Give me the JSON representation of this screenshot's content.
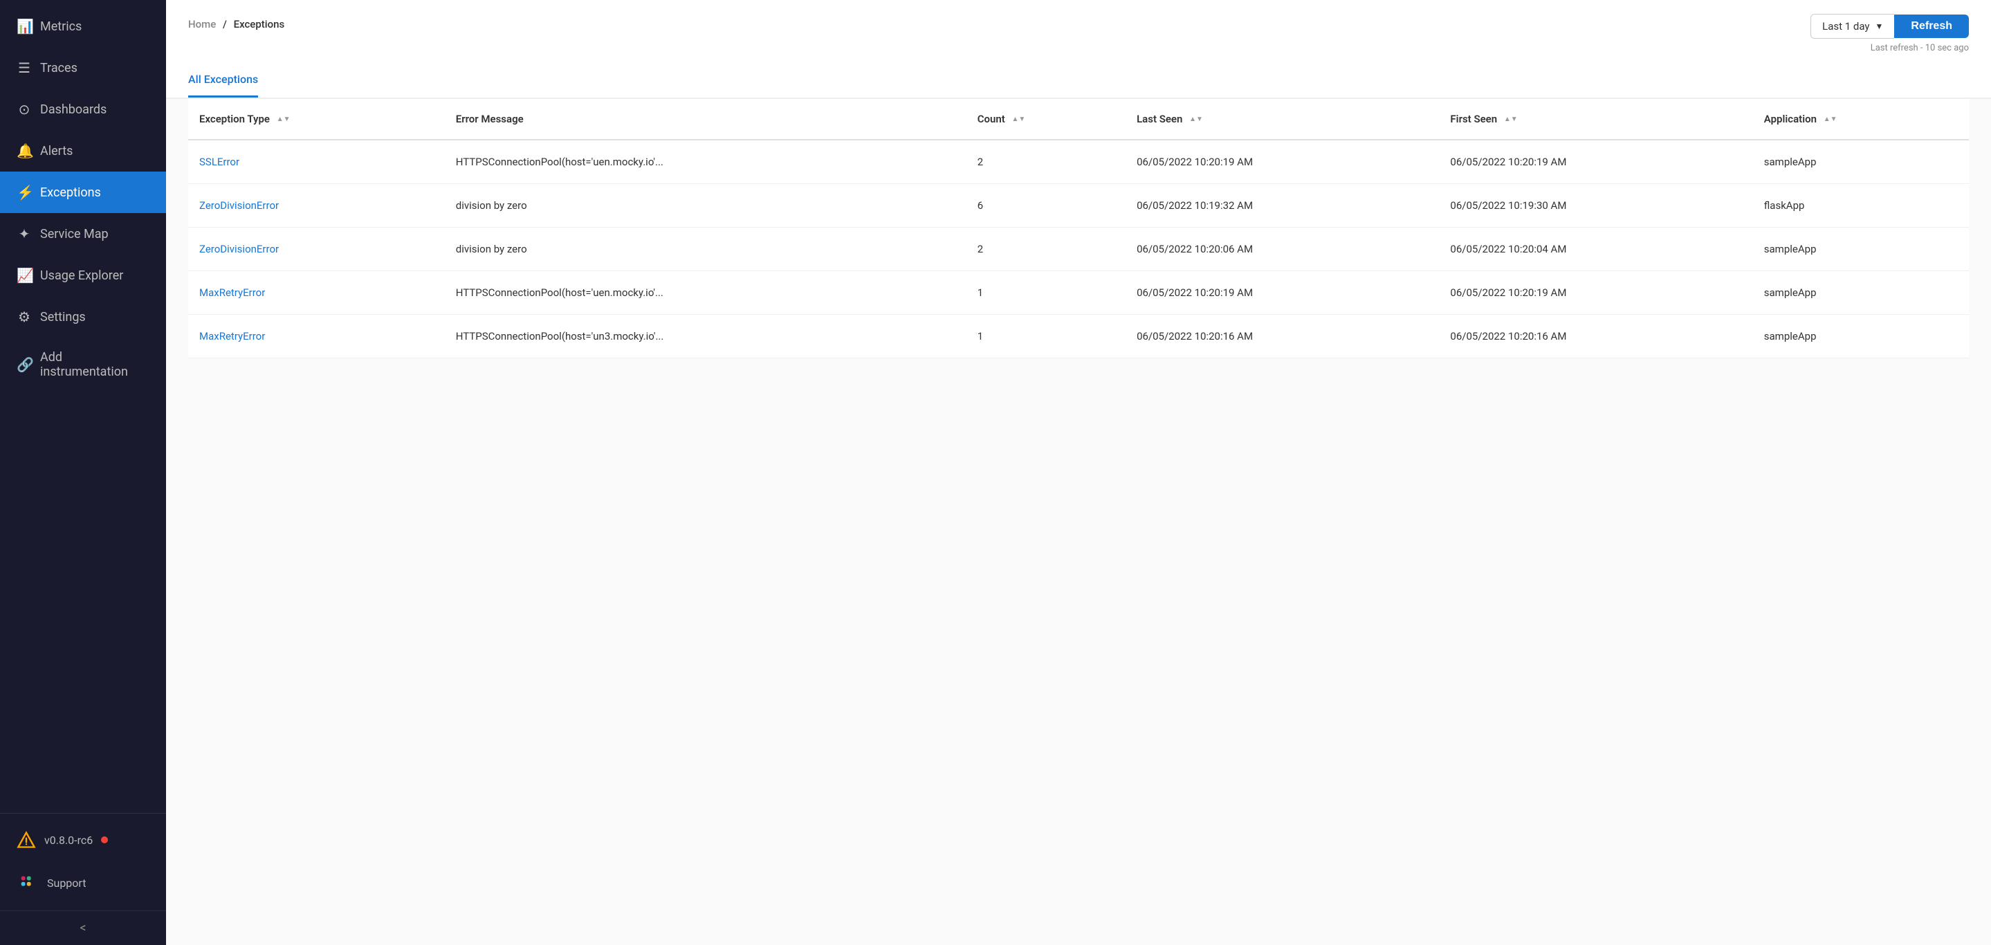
{
  "sidebar": {
    "items": [
      {
        "id": "metrics",
        "label": "Metrics",
        "icon": "📊",
        "active": false
      },
      {
        "id": "traces",
        "label": "Traces",
        "icon": "☰",
        "active": false
      },
      {
        "id": "dashboards",
        "label": "Dashboards",
        "icon": "⊙",
        "active": false
      },
      {
        "id": "alerts",
        "label": "Alerts",
        "icon": "🔔",
        "active": false
      },
      {
        "id": "exceptions",
        "label": "Exceptions",
        "icon": "⚡",
        "active": true
      },
      {
        "id": "service-map",
        "label": "Service Map",
        "icon": "✦",
        "active": false
      },
      {
        "id": "usage-explorer",
        "label": "Usage Explorer",
        "icon": "📈",
        "active": false
      },
      {
        "id": "settings",
        "label": "Settings",
        "icon": "⚙",
        "active": false
      },
      {
        "id": "add-instrumentation",
        "label": "Add instrumentation",
        "icon": "🔗",
        "active": false
      }
    ],
    "bottom": [
      {
        "id": "version",
        "label": "v0.8.0-rc6",
        "hasbadge": true
      },
      {
        "id": "support",
        "label": "Support"
      }
    ],
    "collapse_label": "<"
  },
  "breadcrumb": {
    "home": "Home",
    "separator": "/",
    "current": "Exceptions"
  },
  "topbar": {
    "time_select_label": "Last 1 day",
    "refresh_button_label": "Refresh",
    "last_refresh_text": "Last refresh - 10 sec ago"
  },
  "tabs": [
    {
      "id": "all-exceptions",
      "label": "All Exceptions",
      "active": true
    }
  ],
  "table": {
    "columns": [
      {
        "id": "exception-type",
        "label": "Exception Type",
        "sortable": true
      },
      {
        "id": "error-message",
        "label": "Error Message",
        "sortable": false
      },
      {
        "id": "count",
        "label": "Count",
        "sortable": true
      },
      {
        "id": "last-seen",
        "label": "Last Seen",
        "sortable": true
      },
      {
        "id": "first-seen",
        "label": "First Seen",
        "sortable": true
      },
      {
        "id": "application",
        "label": "Application",
        "sortable": true
      }
    ],
    "rows": [
      {
        "exception_type": "SSLError",
        "error_message": "HTTPSConnectionPool(host='uen.mocky.io'...",
        "count": "2",
        "last_seen": "06/05/2022 10:20:19 AM",
        "first_seen": "06/05/2022 10:20:19 AM",
        "application": "sampleApp"
      },
      {
        "exception_type": "ZeroDivisionError",
        "error_message": "division by zero",
        "count": "6",
        "last_seen": "06/05/2022 10:19:32 AM",
        "first_seen": "06/05/2022 10:19:30 AM",
        "application": "flaskApp"
      },
      {
        "exception_type": "ZeroDivisionError",
        "error_message": "division by zero",
        "count": "2",
        "last_seen": "06/05/2022 10:20:06 AM",
        "first_seen": "06/05/2022 10:20:04 AM",
        "application": "sampleApp"
      },
      {
        "exception_type": "MaxRetryError",
        "error_message": "HTTPSConnectionPool(host='uen.mocky.io'...",
        "count": "1",
        "last_seen": "06/05/2022 10:20:19 AM",
        "first_seen": "06/05/2022 10:20:19 AM",
        "application": "sampleApp"
      },
      {
        "exception_type": "MaxRetryError",
        "error_message": "HTTPSConnectionPool(host='un3.mocky.io'...",
        "count": "1",
        "last_seen": "06/05/2022 10:20:16 AM",
        "first_seen": "06/05/2022 10:20:16 AM",
        "application": "sampleApp"
      }
    ]
  },
  "colors": {
    "sidebar_bg": "#1a1a2e",
    "active_item": "#1976d2",
    "link": "#1976d2",
    "badge_red": "#f44336"
  }
}
